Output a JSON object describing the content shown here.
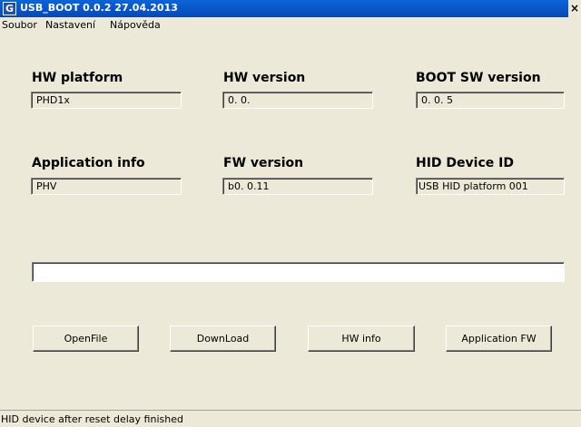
{
  "window": {
    "icon_letter": "G",
    "title": "USB_BOOT  0.0.2 27.04.2013",
    "close_glyph": "×"
  },
  "menu": {
    "items": [
      "Soubor",
      "Nastavení",
      "Nápověda"
    ]
  },
  "fields": {
    "hw_platform": {
      "label": "HW platform",
      "value": "PHD1x"
    },
    "hw_version": {
      "label": "HW version",
      "value": "0. 0."
    },
    "boot_sw_version": {
      "label": "BOOT SW version",
      "value": "0. 0. 5"
    },
    "application_info": {
      "label": "Application info",
      "value": "PHV"
    },
    "fw_version": {
      "label": "FW version",
      "value": "b0. 0.11"
    },
    "hid_device_id": {
      "label": "HID Device ID",
      "value": "USB HID platform  001"
    }
  },
  "progress": {
    "value": 0
  },
  "buttons": {
    "open_file": "OpenFile",
    "download": "DownLoad",
    "hw_info": "HW info",
    "application_fw": "Application FW"
  },
  "status": {
    "text": "HID device after reset delay finished"
  }
}
